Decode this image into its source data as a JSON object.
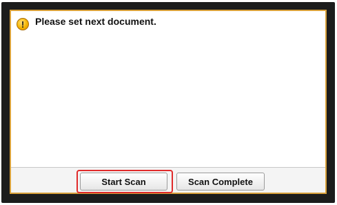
{
  "dialog": {
    "icon": "warning-icon",
    "icon_glyph": "!",
    "message": "Please set next document."
  },
  "buttons": {
    "start_scan_label": "Start Scan",
    "scan_complete_label": "Scan Complete"
  },
  "colors": {
    "frame": "#1c1c1c",
    "screen_border": "#d9a13a",
    "highlight": "#e02a2a",
    "warning_icon": "#f4b400"
  }
}
